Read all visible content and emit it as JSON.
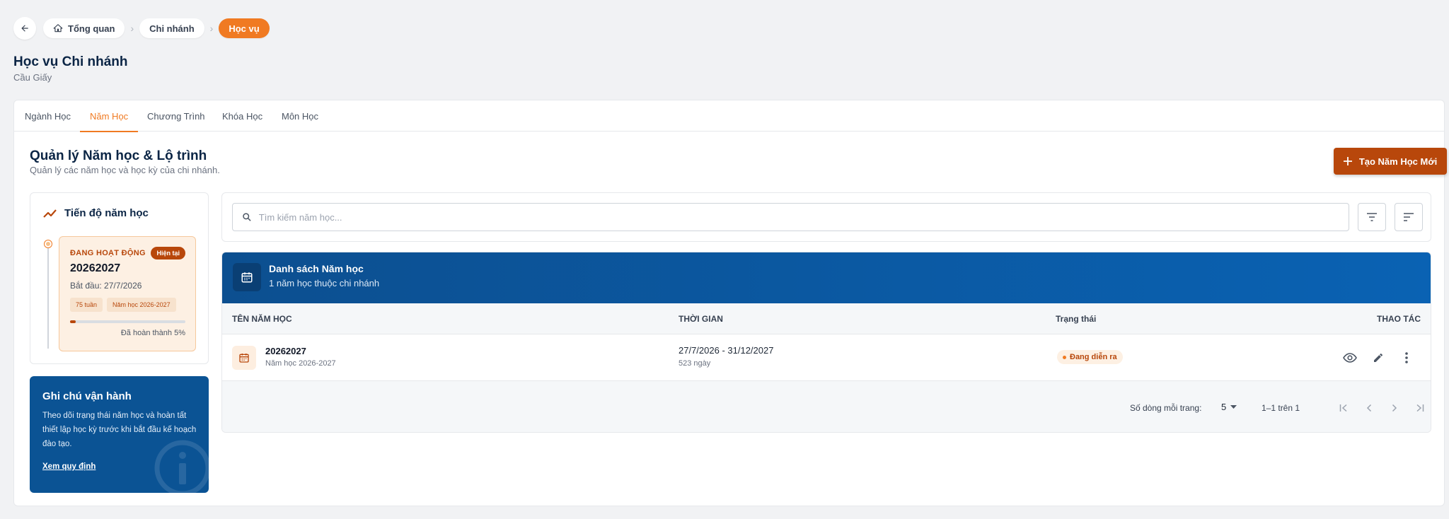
{
  "breadcrumb": {
    "items": [
      {
        "label": "Tổng quan",
        "icon": "home-icon"
      },
      {
        "label": "Chi nhánh"
      },
      {
        "label": "Học vụ",
        "active": true
      }
    ]
  },
  "page": {
    "title": "Học vụ Chi nhánh",
    "subtitle": "Cầu Giấy"
  },
  "tabs": [
    {
      "label": "Ngành Học",
      "active": false
    },
    {
      "label": "Năm Học",
      "active": true
    },
    {
      "label": "Chương Trình",
      "active": false
    },
    {
      "label": "Khóa Học",
      "active": false
    },
    {
      "label": "Môn Học",
      "active": false
    }
  ],
  "section": {
    "title": "Quản lý Năm học & Lộ trình",
    "subtitle": "Quản lý các năm học và học kỳ của chi nhánh.",
    "create_button": "Tạo Năm Học Mới"
  },
  "progress": {
    "title": "Tiến độ năm học",
    "card": {
      "status": "ĐANG HOẠT ĐỘNG",
      "badge": "Hiện tại",
      "year": "20262027",
      "start": "Bắt đầu: 27/7/2026",
      "chips": [
        "75 tuần",
        "Năm học 2026-2027"
      ],
      "percent": 5,
      "done_text": "Đã hoàn thành 5%"
    }
  },
  "note": {
    "title": "Ghi chú vận hành",
    "text": "Theo dõi trạng thái năm học và hoàn tất thiết lập học kỳ trước khi bắt đầu kế hoạch đào tạo.",
    "link": "Xem quy định"
  },
  "search": {
    "placeholder": "Tìm kiếm năm học..."
  },
  "table": {
    "title": "Danh sách Năm học",
    "subtitle": "1 năm học thuộc chi nhánh",
    "columns": [
      "TÊN NĂM HỌC",
      "THỜI GIAN",
      "Trạng thái",
      "THAO TÁC"
    ],
    "rows": [
      {
        "name": "20262027",
        "name_sub": "Năm học 2026-2027",
        "time": "27/7/2026 - 31/12/2027",
        "days": "523 ngày",
        "status": "Đang diễn ra"
      }
    ],
    "footer": {
      "rows_label": "Số dòng mỗi trang:",
      "rows_value": "5",
      "range": "1–1 trên 1"
    }
  },
  "colors": {
    "accent": "#f07a22",
    "accent_dark": "#b8470b",
    "primary_blue": "#0b5394",
    "navy": "#0b2545"
  }
}
